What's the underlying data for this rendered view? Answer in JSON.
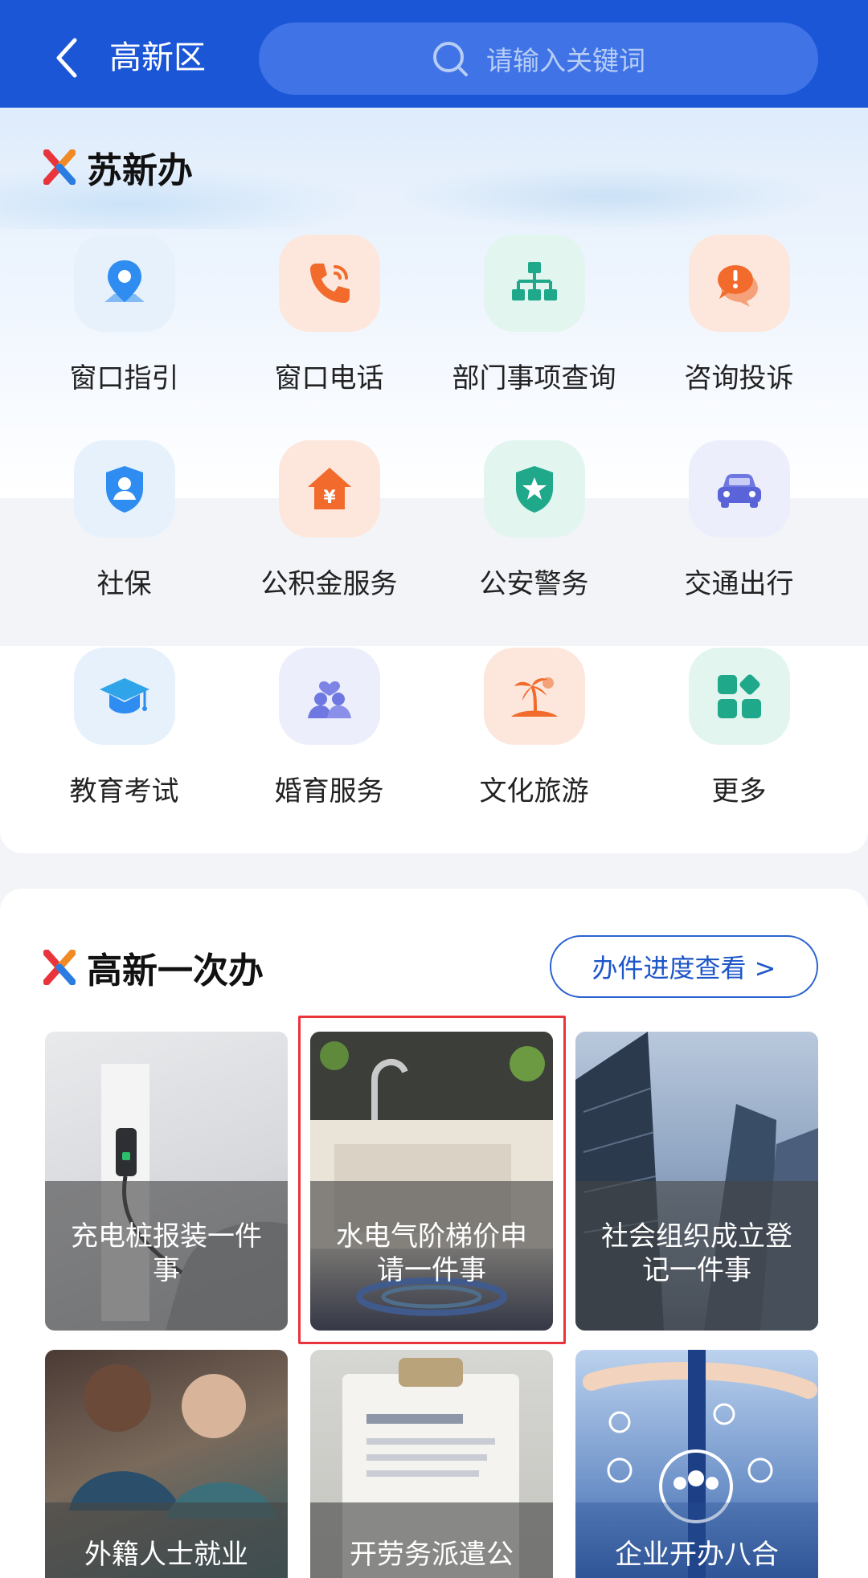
{
  "header": {
    "title": "高新区",
    "search_placeholder": "请输入关键词"
  },
  "section1": {
    "title": "苏新办",
    "items": [
      {
        "label": "窗口指引",
        "icon": "location-pin-icon"
      },
      {
        "label": "窗口电话",
        "icon": "phone-icon"
      },
      {
        "label": "部门事项查询",
        "icon": "org-chart-icon"
      },
      {
        "label": "咨询投诉",
        "icon": "chat-alert-icon"
      },
      {
        "label": "社保",
        "icon": "shield-user-icon"
      },
      {
        "label": "公积金服务",
        "icon": "house-yuan-icon"
      },
      {
        "label": "公安警务",
        "icon": "police-badge-icon"
      },
      {
        "label": "交通出行",
        "icon": "car-icon"
      },
      {
        "label": "教育考试",
        "icon": "graduation-cap-icon"
      },
      {
        "label": "婚育服务",
        "icon": "couple-heart-icon"
      },
      {
        "label": "文化旅游",
        "icon": "palm-island-icon"
      },
      {
        "label": "更多",
        "icon": "apps-grid-icon"
      }
    ]
  },
  "section2": {
    "title": "高新一次办",
    "progress_button": "办件进度查看 >",
    "cards": [
      {
        "label": "充电桩报装一件事"
      },
      {
        "label": "水电气阶梯价申请一件事"
      },
      {
        "label": "社会组织成立登记一件事"
      },
      {
        "label": "外籍人士就业"
      },
      {
        "label": "开劳务派遣公"
      },
      {
        "label": "企业开办八合"
      }
    ]
  },
  "colors": {
    "header_blue": "#1a56d6",
    "accent_blue": "#2a62d0",
    "highlight_red": "#e8343a"
  }
}
